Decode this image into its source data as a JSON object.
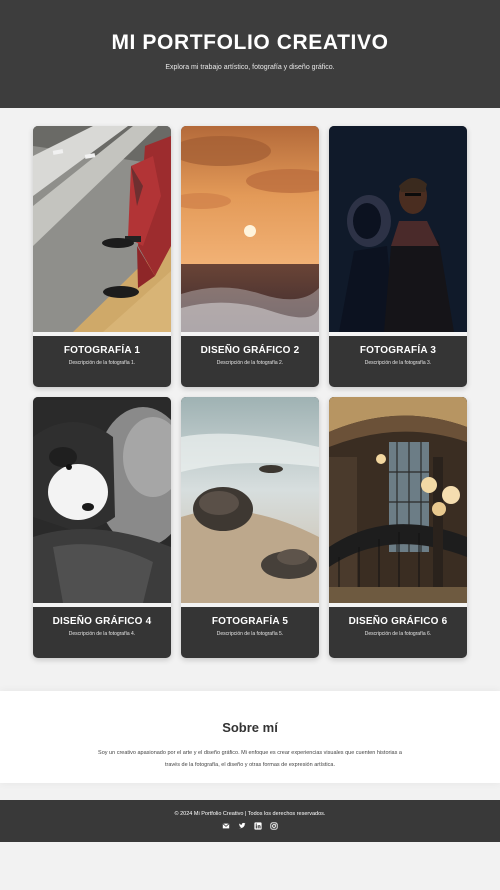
{
  "header": {
    "title": "MI PORTFOLIO CREATIVO",
    "subtitle": "Explora mi trabajo artístico, fotografía y diseño gráfico."
  },
  "gallery": {
    "items": [
      {
        "title": "FOTOGRAFÍA 1",
        "description": "Descripción de la fotografía 1.",
        "image": "street-legs-photo"
      },
      {
        "title": "DISEÑO GRÁFICO 2",
        "description": "Descripción de la fotografía 2.",
        "image": "sunset-sea-photo"
      },
      {
        "title": "FOTOGRAFÍA 3",
        "description": "Descripción de la fotografía 3.",
        "image": "man-shadow-photo"
      },
      {
        "title": "DISEÑO GRÁFICO 4",
        "description": "Descripción de la fotografía 4.",
        "image": "puppy-person-photo"
      },
      {
        "title": "FOTOGRAFÍA 5",
        "description": "Descripción de la fotografía 5.",
        "image": "beach-rocks-photo"
      },
      {
        "title": "DISEÑO GRÁFICO 6",
        "description": "Descripción de la fotografía 6.",
        "image": "staircase-lamps-photo"
      }
    ]
  },
  "about": {
    "title": "Sobre mí",
    "text": "Soy un creativo apasionado por el arte y el diseño gráfico. Mi enfoque es crear experiencias visuales que cuenten historias a través de la fotografía, el diseño y otras formas de expresión artística."
  },
  "footer": {
    "copyright": "© 2024 Mi Portfolio Creativo | Todos los derechos reservados.",
    "icons": [
      "envelope-icon",
      "twitter-icon",
      "linkedin-icon",
      "instagram-icon"
    ]
  },
  "colors": {
    "header_bg": "#3d3d3d",
    "caption_bg": "#353535",
    "footer_bg": "#393939",
    "page_bg": "#f2f2f2"
  }
}
